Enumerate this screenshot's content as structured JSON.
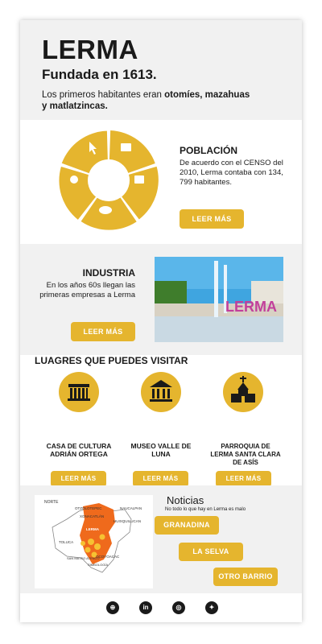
{
  "header": {
    "title": "LERMA",
    "subtitle": "Fundada en 1613.",
    "intro_prefix": "Los primeros habitantes eran ",
    "intro_bold": "otomíes, mazahuas y matlatzincas."
  },
  "poblacion": {
    "heading": "POBLACIÓN",
    "text": "De acuerdo con el CENSO del 2010, Lerma contaba con 134, 799 habitantes.",
    "button": "LEER MÁS"
  },
  "industria": {
    "heading": "INDUSTRIA",
    "text": "En los años 60s llegan las primeras empresas a Lerma",
    "button": "LEER MÁS",
    "photo_sign": "LERMA"
  },
  "lugares": {
    "heading": "LUAGRES QUE PUEDES VISITAR",
    "items": [
      {
        "name": "CASA DE CULTURA ADRIÁN ORTEGA",
        "button": "LEER MÁS"
      },
      {
        "name": "MUSEO VALLE DE LUNA",
        "button": "LEER MÁS"
      },
      {
        "name": "PARROQUIA DE LERMA SANTA CLARA DE ASÍS",
        "button": "LEER MÁS"
      }
    ]
  },
  "noticias": {
    "heading": "Noticias",
    "subheading": "No todo lo que hay en Lerma es malo",
    "buttons": [
      "GRANADINA",
      "LA SELVA",
      "OTRO BARRIO"
    ],
    "map_labels": [
      "NORTE",
      "OTZOLOTEPEC",
      "XONACATLÁN",
      "LERMA",
      "NAUCALPAN",
      "HUIXQUILUCAN",
      "TOLUCA",
      "SAN MATEO ATENCO",
      "OCOYOACAC",
      "SIMBOLOGÍA"
    ]
  },
  "footer": {
    "icons": [
      "globe-icon",
      "linkedin-icon",
      "instagram-icon",
      "twitter-icon"
    ]
  },
  "colors": {
    "accent": "#e5b52e",
    "section_grey": "#f1f1f1",
    "text": "#1a1a1a"
  }
}
